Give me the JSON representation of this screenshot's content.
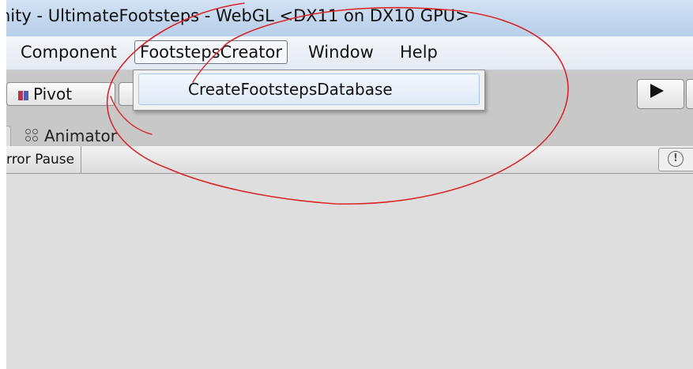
{
  "window": {
    "title": "nity - UltimateFootsteps - WebGL <DX11 on DX10 GPU>"
  },
  "menubar": {
    "items": [
      {
        "label": "Component"
      },
      {
        "label": "FootstepsCreator",
        "active": true
      },
      {
        "label": "Window"
      },
      {
        "label": "Help"
      }
    ]
  },
  "dropdown": {
    "items": [
      {
        "label": "CreateFootstepsDatabase"
      }
    ]
  },
  "toolbar": {
    "pivot_label": "Pivot",
    "play_icon": "play-icon"
  },
  "tabs": [
    {
      "label": ""
    },
    {
      "label": "Animator",
      "icon": "animator-icon"
    }
  ],
  "console": {
    "error_pause_label": "rror Pause",
    "warn_icon": "!"
  },
  "annotation": {
    "color": "#d8262a"
  }
}
